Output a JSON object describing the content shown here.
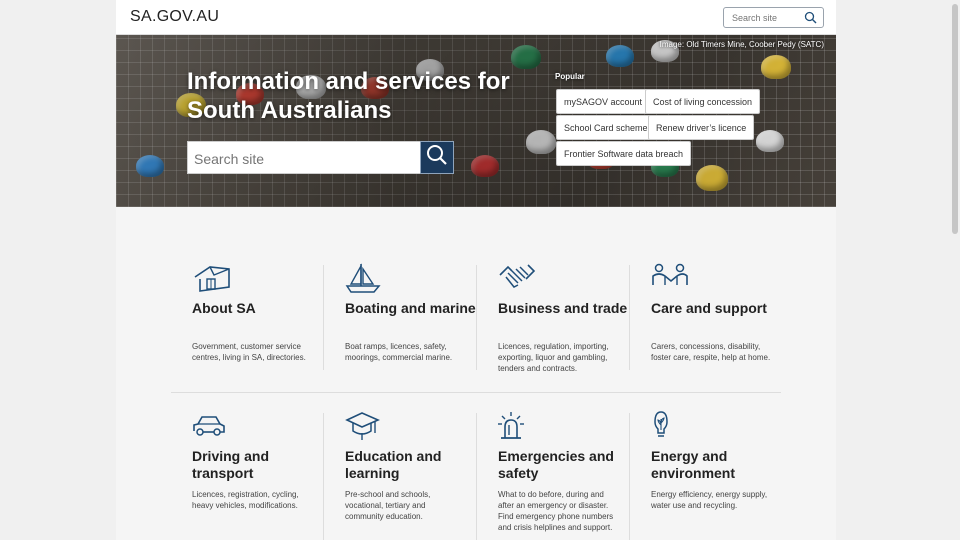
{
  "header": {
    "logo": "SA.GOV.AU",
    "search_placeholder": "Search site"
  },
  "hero": {
    "credit": "Image:  Old Timers Mine, Coober Pedy (SATC)",
    "title": "Information and services for South Australians",
    "search_placeholder": "Search site",
    "popular_label": "Popular",
    "popular": [
      "mySAGOV account",
      "Cost of living concession",
      "School Card scheme",
      "Renew driver’s licence",
      "Frontier Software data breach"
    ]
  },
  "topics": [
    {
      "icon": "house-icon",
      "title": "About SA",
      "desc": "Government, customer service centres, living in SA, directories."
    },
    {
      "icon": "sailboat-icon",
      "title": "Boating and marine",
      "desc": "Boat ramps, licences, safety, moorings, commercial marine."
    },
    {
      "icon": "handshake-icon",
      "title": "Business and trade",
      "desc": "Licences, regulation, importing, exporting, liquor and gambling, tenders and contracts."
    },
    {
      "icon": "people-support-icon",
      "title": "Care and support",
      "desc": "Carers, concessions, disability, foster care, respite, help at home."
    },
    {
      "icon": "car-icon",
      "title": "Driving and transport",
      "desc": "Licences, registration, cycling, heavy vehicles, modifications."
    },
    {
      "icon": "graduation-cap-icon",
      "title": "Education and learning",
      "desc": "Pre-school and schools, vocational, tertiary and community education."
    },
    {
      "icon": "siren-icon",
      "title": "Emergencies and safety",
      "desc": "What to do before, during and after an emergency or disaster. Find emergency phone numbers and crisis helplines and support."
    },
    {
      "icon": "lightbulb-leaf-icon",
      "title": "Energy and environment",
      "desc": "Energy efficiency, energy supply, water use and recycling."
    }
  ],
  "colors": {
    "brand_navy": "#1b3a5c",
    "icon_blue": "#1f4e79"
  }
}
